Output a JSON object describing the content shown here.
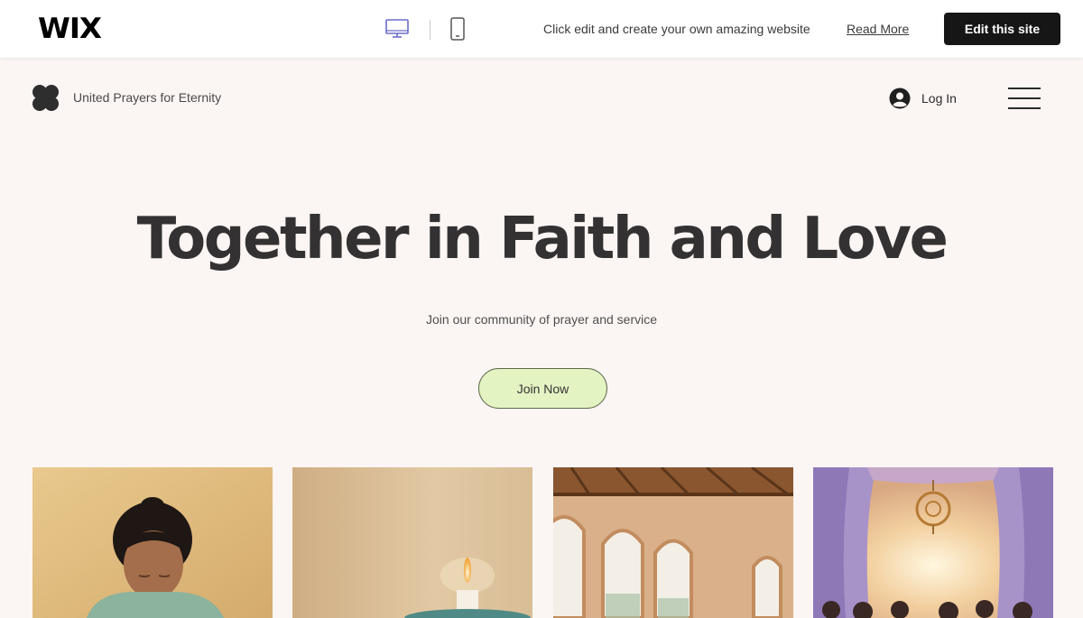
{
  "wix_bar": {
    "logo": "WIX",
    "devices": [
      "desktop-icon",
      "mobile-icon"
    ],
    "message": "Click edit and create your own amazing website",
    "read_more": "Read More",
    "edit_button": "Edit this site"
  },
  "site_header": {
    "logo_icon": "clover-icon",
    "site_name": "United Prayers for Eternity",
    "login_icon": "user-avatar-icon",
    "login_label": "Log In",
    "menu_icon": "hamburger-menu-icon"
  },
  "hero": {
    "title": "Together in Faith and Love",
    "subtitle": "Join our community of prayer and service",
    "cta": "Join Now"
  },
  "gallery": [
    {
      "subject": "woman praying"
    },
    {
      "subject": "lit candle"
    },
    {
      "subject": "arched windows room"
    },
    {
      "subject": "sunlit chapel with curtains"
    }
  ],
  "colors": {
    "page_bg": "#fbf5f3",
    "title": "#333132",
    "cta_bg": "#e4f3c2",
    "edit_bg": "#161616"
  }
}
